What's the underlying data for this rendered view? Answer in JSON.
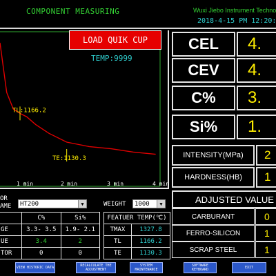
{
  "header": {
    "title": "COMPONENT MEASURING",
    "company": "Wuxi Jiebo Instrument Technolo",
    "datetime": "2018-4-15 PM 12:20:30"
  },
  "chart": {
    "load_button": "LOAD QUIK CUP",
    "temp_label": "TEMP:9999",
    "tl_label": "TL:1166.2",
    "te_label": "TE:1130.3",
    "x_ticks": [
      "1 min",
      "2 min",
      "3 min",
      "4 min"
    ]
  },
  "chart_data": {
    "type": "line",
    "x_ticks": [
      "1 min",
      "2 min",
      "3 min",
      "4 min"
    ],
    "annotations": [
      "TL:1166.2",
      "TE:1130.3"
    ],
    "series": [
      {
        "color": "#e00000",
        "x": [
          0.0,
          0.15,
          0.3,
          0.45,
          0.6,
          0.8,
          1.1,
          1.5,
          2.0,
          2.5,
          3.0,
          3.5
        ],
        "y": [
          1230,
          1185,
          1170,
          1166,
          1163,
          1156,
          1148,
          1140,
          1136,
          1134,
          1131,
          1129
        ]
      }
    ]
  },
  "results": {
    "rows": [
      {
        "name": "CEL",
        "value": "4."
      },
      {
        "name": "CEV",
        "value": "4."
      },
      {
        "name": "C%",
        "value": "3."
      },
      {
        "name": "Si%",
        "value": "1."
      }
    ],
    "intensity": {
      "name": "INTENSITY(MPa)",
      "value": "2"
    },
    "hardness": {
      "name": "HARDNESS(HB)",
      "value": "1"
    }
  },
  "adjusted": {
    "title": "ADJUSTED VALUE",
    "rows": [
      {
        "name": "CARBURANT",
        "value": "0"
      },
      {
        "name": "FERRO-SILICON",
        "value": "1"
      },
      {
        "name": "SCRAP STEEL",
        "value": "1"
      }
    ]
  },
  "grade": {
    "label_line1": "OR",
    "label_line2": "AME",
    "value": "HT200",
    "weight_label": "WEIGHT",
    "weight_value": "1000"
  },
  "composition": {
    "headers": [
      "C%",
      "Si%"
    ],
    "rows": [
      {
        "label": "GE",
        "c": "3.3- 3.5",
        "si": "1.9- 2.1"
      },
      {
        "label": "UE",
        "c": "3.4",
        "si": "2"
      },
      {
        "label": "TOR",
        "c": "0",
        "si": "0"
      }
    ]
  },
  "feature": {
    "header": "FEATUER TEMP(℃)",
    "rows": [
      {
        "name": "TMAX",
        "value": "1327.8"
      },
      {
        "name": "TL",
        "value": "1166.2"
      },
      {
        "name": "TE",
        "value": "1130.3"
      }
    ]
  },
  "buttons": {
    "view_historic": "VIEW HISTORIC DATA",
    "recalculate": "RECALCULATE THE ADJUSTMENT",
    "system_maintenance": "SYSTEM MAINTENANCE",
    "software_keyboard": "SOFTWARE KEYBOARD",
    "exit": "EXIT"
  }
}
